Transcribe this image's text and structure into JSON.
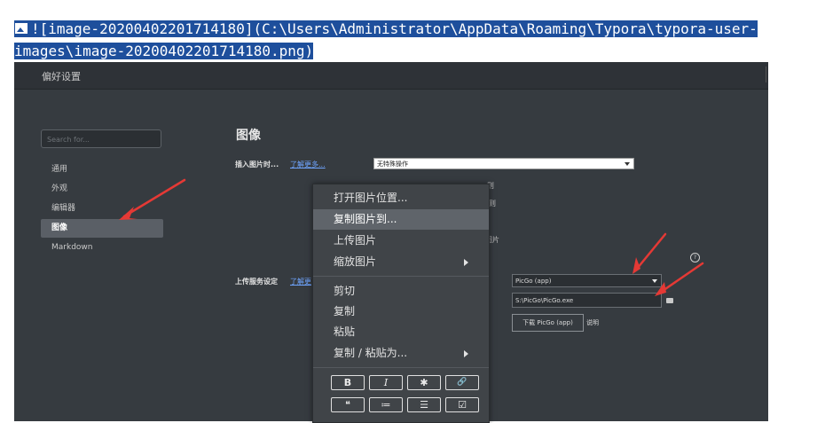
{
  "markdown_line": {
    "text": "![image-20200402201714180](C:\\Users\\Administrator\\AppData\\Roaming\\Typora\\typora-user-images\\image-20200402201714180.png)"
  },
  "window": {
    "title": "偏好设置"
  },
  "sidebar": {
    "search_placeholder": "Search for...",
    "items": [
      {
        "label": "通用"
      },
      {
        "label": "外观"
      },
      {
        "label": "编辑器"
      },
      {
        "label": "图像"
      },
      {
        "label": "Markdown"
      }
    ]
  },
  "image_section": {
    "title": "图像",
    "insert_label": "插入图片时...",
    "insert_link": "了解更多...",
    "insert_select_value": "无特殊操作",
    "hidden_text_1": "则",
    "hidden_text_2": "则",
    "hidden_text_3": "图片",
    "upload_label": "上传服务设定",
    "upload_link": "了解更",
    "uploader_select_value": "PicGo (app)",
    "picgo_path": "S:\\PicGo\\PicGo.exe",
    "download_button": "下载 PicGo (app)",
    "download_note": "说明",
    "help_icon": "?"
  },
  "context_menu": {
    "items": [
      {
        "label": "打开图片位置..."
      },
      {
        "label": "复制图片到..."
      },
      {
        "label": "上传图片"
      },
      {
        "label": "缩放图片"
      },
      {
        "label": "剪切"
      },
      {
        "label": "复制"
      },
      {
        "label": "粘贴"
      },
      {
        "label": "复制 / 粘贴为..."
      }
    ],
    "format_buttons": [
      {
        "glyph": "B"
      },
      {
        "glyph": "I"
      },
      {
        "glyph": "✱"
      },
      {
        "glyph": "🔗"
      },
      {
        "glyph": "❝"
      },
      {
        "glyph": "≔"
      },
      {
        "glyph": "☰"
      },
      {
        "glyph": "☑"
      }
    ]
  },
  "colors": {
    "selection": "#1e4f9c",
    "window_bg": "#363b40",
    "menu_bg": "#404448",
    "menu_highlight": "#5f646a",
    "annotation": "#e53935",
    "link": "#6fa5ff"
  }
}
